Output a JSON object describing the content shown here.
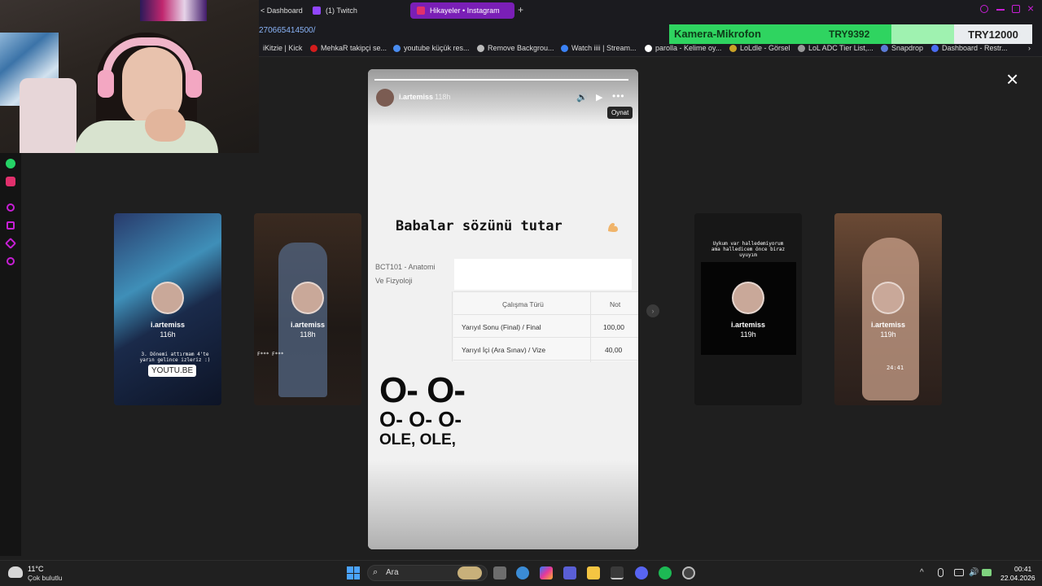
{
  "browser": {
    "tabs": [
      {
        "label": "< Dashboard"
      },
      {
        "label": "(1) Twitch"
      },
      {
        "label": "Hikayeler • Instagram"
      }
    ],
    "new_tab": "+",
    "url": "270665414500/",
    "bookmarks": [
      {
        "label": "iKitzie | Kick"
      },
      {
        "label": "MehkaR takipçi se..."
      },
      {
        "label": "youtube küçük res..."
      },
      {
        "label": "Remove Backgrou..."
      },
      {
        "label": "Watch iiii | Stream..."
      },
      {
        "label": "parolla - Kelime oy..."
      },
      {
        "label": "LoLdle - Görsel"
      },
      {
        "label": "LoL ADC Tier List,..."
      },
      {
        "label": "Snapdrop"
      },
      {
        "label": "Dashboard - Restr..."
      }
    ]
  },
  "donation": {
    "label": "Kamera-Mikrofon",
    "current": "TRY9392",
    "goal": "TRY12000",
    "progress": 0.78,
    "color": "#2fd460"
  },
  "story": {
    "username": "i.artemiss",
    "time": "118h",
    "tooltip": "Oynat",
    "headline": "Babalar sözünü tutar",
    "course_line1": "BCT101 - Anatomi",
    "course_line2": "Ve Fizyoloji",
    "table": {
      "headers": [
        "Çalışma Türü",
        "Not"
      ],
      "rows": [
        [
          "Yarıyıl Sonu (Final) / Final",
          "100,00"
        ],
        [
          "Yarıyıl İçi (Ara Sınav) / Vize",
          "40,00"
        ]
      ]
    },
    "big_line": "O- O-",
    "mid_line": "O- O- O-",
    "ole_line": "OLE, OLE,"
  },
  "cards": [
    {
      "name": "i.artemiss",
      "time": "116h",
      "caption": "3. Dönemi attırmam 4'te yarın gelince izleriz :)",
      "link": "YOUTU.BE"
    },
    {
      "name": "i.artemiss",
      "time": "118h",
      "caption": "F*** F***"
    },
    {
      "name": "i.artemiss",
      "time": "119h",
      "caption": "Uykum var halledemiyorum ama halledicem önce biraz uyuyım"
    },
    {
      "name": "i.artemiss",
      "time": "119h",
      "caption": "24:41"
    }
  ],
  "taskbar": {
    "weather_temp": "11°C",
    "weather_desc": "Çok bulutlu",
    "search_label": "Ara",
    "time": "00:41",
    "date": "22.04.2026"
  },
  "icons": {
    "close": "×",
    "sound": "🔊",
    "play": "▶",
    "more": "•••",
    "search": "⌕",
    "arrow": "›"
  }
}
